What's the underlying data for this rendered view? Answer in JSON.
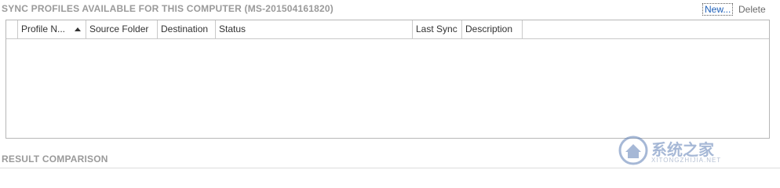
{
  "sync_section": {
    "title": "SYNC PROFILES AVAILABLE FOR THIS COMPUTER (MS-201504161820)",
    "actions": {
      "new_label": "New...",
      "delete_label": "Delete"
    },
    "columns": [
      {
        "label": "Profile N...",
        "sorted": "ascending"
      },
      {
        "label": "Source Folder"
      },
      {
        "label": "Destination"
      },
      {
        "label": "Status"
      },
      {
        "label": "Last Sync"
      },
      {
        "label": "Description"
      }
    ],
    "rows": []
  },
  "result_section": {
    "title": "RESULT COMPARISON"
  },
  "watermark": {
    "text": "系统之家",
    "sub_text": "XITONGZHIJIA.NET",
    "icon": "house-logo-icon"
  },
  "colors": {
    "link": "#1d5fb8",
    "header_text": "#9a9a9a",
    "border": "#b7b7b7"
  }
}
